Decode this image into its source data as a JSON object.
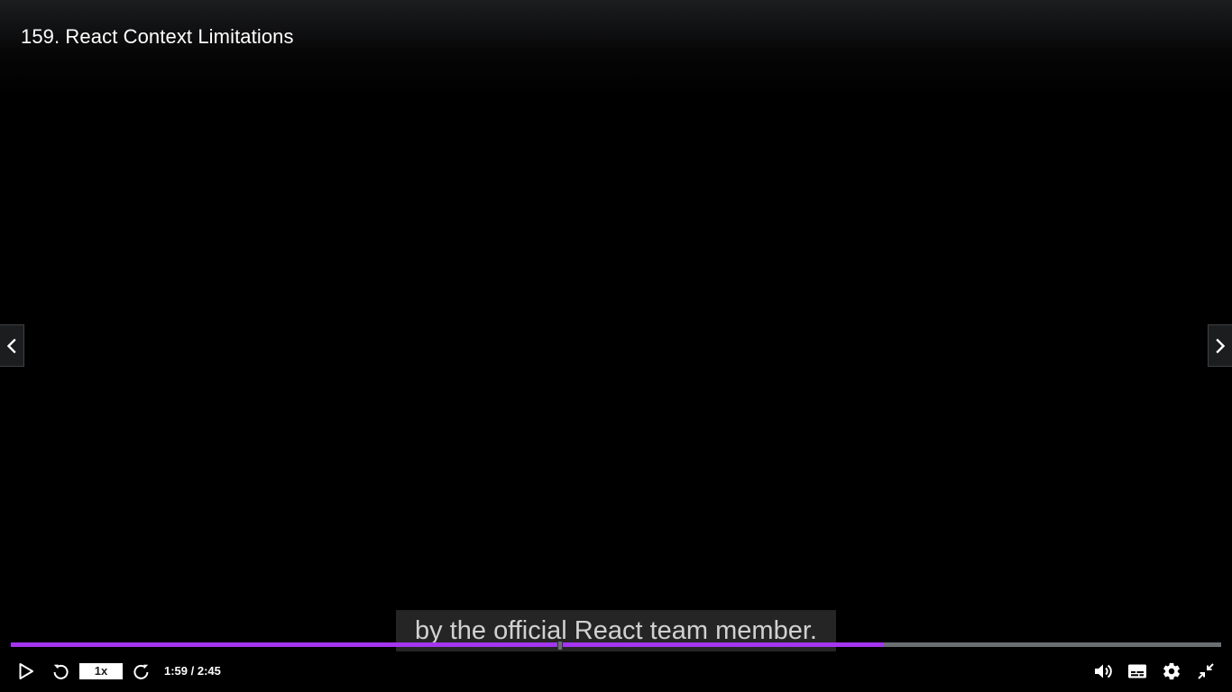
{
  "video": {
    "title": "159. React Context Limitations",
    "caption": "by the official React team member."
  },
  "playback": {
    "current_time": "1:59",
    "duration": "2:45",
    "time_separator": " / ",
    "time_display": "1:59 / 2:45",
    "speed_label": "1x",
    "played_fraction": 0.7212,
    "buffered_fraction": 0.7212,
    "state": "paused"
  },
  "colors": {
    "accent": "#a435f0",
    "track": "#6a6f73",
    "control_icon": "#ffffff",
    "caption_bg": "#282828",
    "caption_text": "#d1d1d1"
  },
  "icons": {
    "previous": "chevron-left-icon",
    "next": "chevron-right-icon",
    "play": "play-icon",
    "rewind": "rewind-5-icon",
    "forward": "forward-5-icon",
    "volume": "volume-icon",
    "captions": "closed-captions-icon",
    "settings": "gear-icon",
    "exit_fullscreen": "exit-fullscreen-icon"
  }
}
